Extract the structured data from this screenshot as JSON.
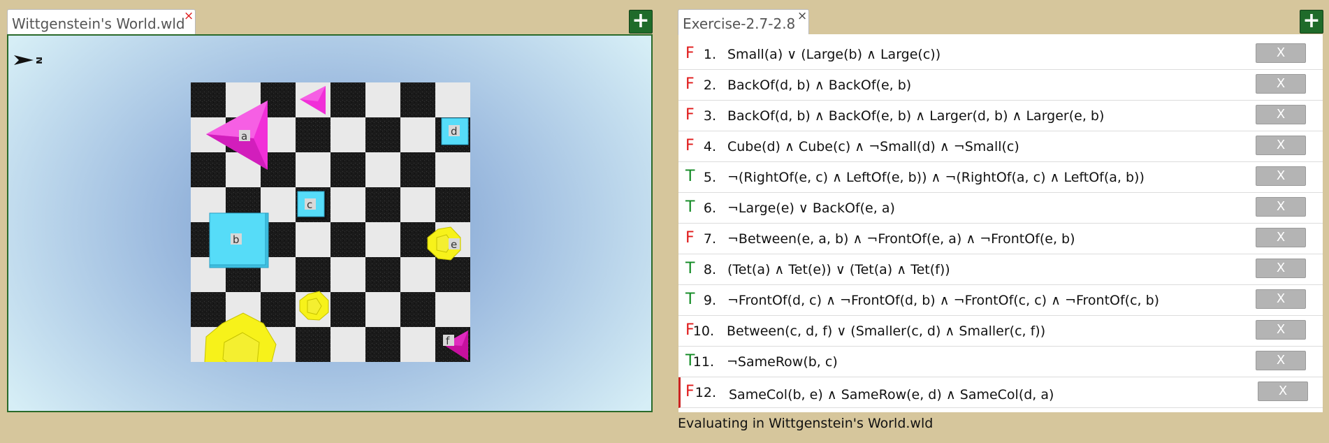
{
  "world_tab": {
    "title": "Wittgenstein's World.wld",
    "close": "×"
  },
  "sentence_tab": {
    "title": "Exercise-2.7-2.8",
    "close": "×"
  },
  "add_label": "+",
  "compass": {
    "label": "N"
  },
  "objects": [
    {
      "label": "a",
      "shape": "tet",
      "size": "large",
      "color": "#f12fd8"
    },
    {
      "label": "b",
      "shape": "cube",
      "size": "large",
      "color": "#56dcf8"
    },
    {
      "label": "c",
      "shape": "cube",
      "size": "small",
      "color": "#56dcf8"
    },
    {
      "label": "d",
      "shape": "cube",
      "size": "small",
      "color": "#56dcf8"
    },
    {
      "label": "e",
      "shape": "dodec",
      "size": "small",
      "color": "#f7f21a"
    },
    {
      "label": "f",
      "shape": "tet",
      "size": "small",
      "color": "#c7109f"
    }
  ],
  "sentences": [
    {
      "truth": "F",
      "num": "1.",
      "text": "Small(a) ∨ (Large(b) ∧ Large(c))",
      "remove": "X"
    },
    {
      "truth": "F",
      "num": "2.",
      "text": "BackOf(d, b) ∧ BackOf(e, b)",
      "remove": "X"
    },
    {
      "truth": "F",
      "num": "3.",
      "text": "BackOf(d, b) ∧ BackOf(e, b) ∧ Larger(d, b) ∧ Larger(e, b)",
      "remove": "X"
    },
    {
      "truth": "F",
      "num": "4.",
      "text": "Cube(d) ∧ Cube(c) ∧ ¬Small(d) ∧ ¬Small(c)",
      "remove": "X"
    },
    {
      "truth": "T",
      "num": "5.",
      "text": "¬(RightOf(e, c) ∧ LeftOf(e, b)) ∧ ¬(RightOf(a, c) ∧ LeftOf(a, b))",
      "remove": "X"
    },
    {
      "truth": "T",
      "num": "6.",
      "text": "¬Large(e) ∨ BackOf(e, a)",
      "remove": "X"
    },
    {
      "truth": "F",
      "num": "7.",
      "text": "¬Between(e, a, b) ∧ ¬FrontOf(e, a) ∧ ¬FrontOf(e, b)",
      "remove": "X"
    },
    {
      "truth": "T",
      "num": "8.",
      "text": "(Tet(a) ∧ Tet(e)) ∨ (Tet(a) ∧ Tet(f))",
      "remove": "X"
    },
    {
      "truth": "T",
      "num": "9.",
      "text": "¬FrontOf(d, c) ∧ ¬FrontOf(d, b) ∧ ¬FrontOf(c, c) ∧ ¬FrontOf(c, b)",
      "remove": "X"
    },
    {
      "truth": "F",
      "num": "10.",
      "text": "Between(c, d, f) ∨ (Smaller(c, d) ∧ Smaller(c, f))",
      "remove": "X"
    },
    {
      "truth": "T",
      "num": "11.",
      "text": "¬SameRow(b, c)",
      "remove": "X"
    },
    {
      "truth": "F",
      "num": "12.",
      "text": "SameCol(b, e) ∧ SameRow(e, d) ∧ SameCol(d, a)",
      "remove": "X",
      "selected": true
    }
  ],
  "status": "Evaluating in Wittgenstein's World.wld",
  "colors": {
    "true": "#118a23",
    "false": "#e01a1a",
    "add_button": "#1f6b2a"
  }
}
